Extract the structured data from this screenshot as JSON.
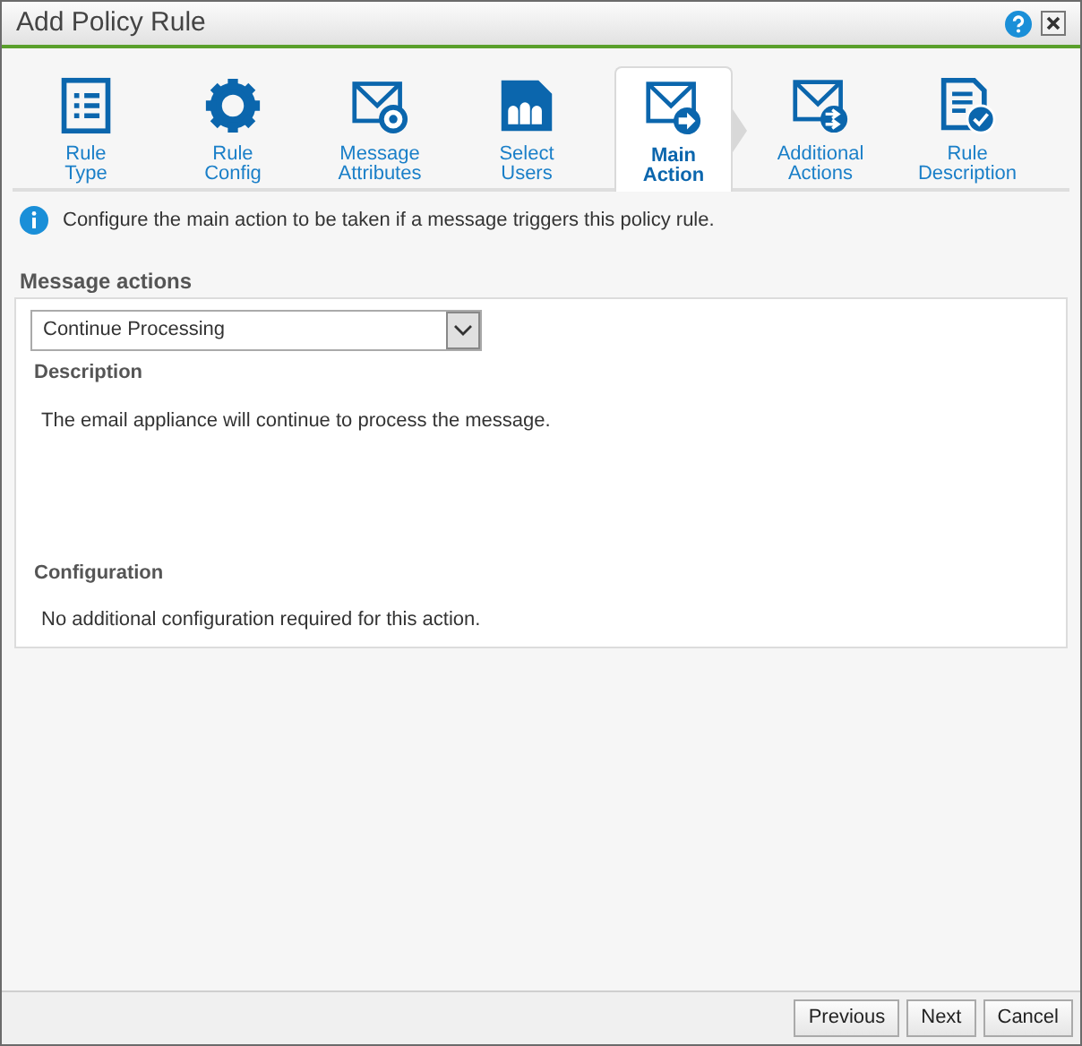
{
  "window": {
    "title": "Add Policy Rule"
  },
  "steps": [
    {
      "kind": "list",
      "label": [
        "Rule",
        "Type"
      ],
      "selected": false
    },
    {
      "kind": "gear",
      "label": [
        "Rule",
        "Config"
      ],
      "selected": false
    },
    {
      "kind": "envelope-gear",
      "label": [
        "Message",
        "Attributes"
      ],
      "selected": false
    },
    {
      "kind": "users",
      "label": [
        "Select",
        "Users"
      ],
      "selected": false
    },
    {
      "kind": "envelope-arrow",
      "label": [
        "Main",
        "Action"
      ],
      "selected": true
    },
    {
      "kind": "envelope-arrows",
      "label": [
        "Additional",
        "Actions"
      ],
      "selected": false
    },
    {
      "kind": "doc-check",
      "label": [
        "Rule",
        "Description"
      ],
      "selected": false
    }
  ],
  "info": "Configure the main action to be taken if a message triggers this policy rule.",
  "message_actions": {
    "label": "Message actions",
    "value": "Continue Processing",
    "description": {
      "heading": "Description",
      "text": "The email appliance will continue to process the message."
    },
    "configuration": {
      "heading": "Configuration",
      "text": "No additional configuration required for this action."
    }
  },
  "buttons": [
    "Previous",
    "Next",
    "Cancel"
  ]
}
